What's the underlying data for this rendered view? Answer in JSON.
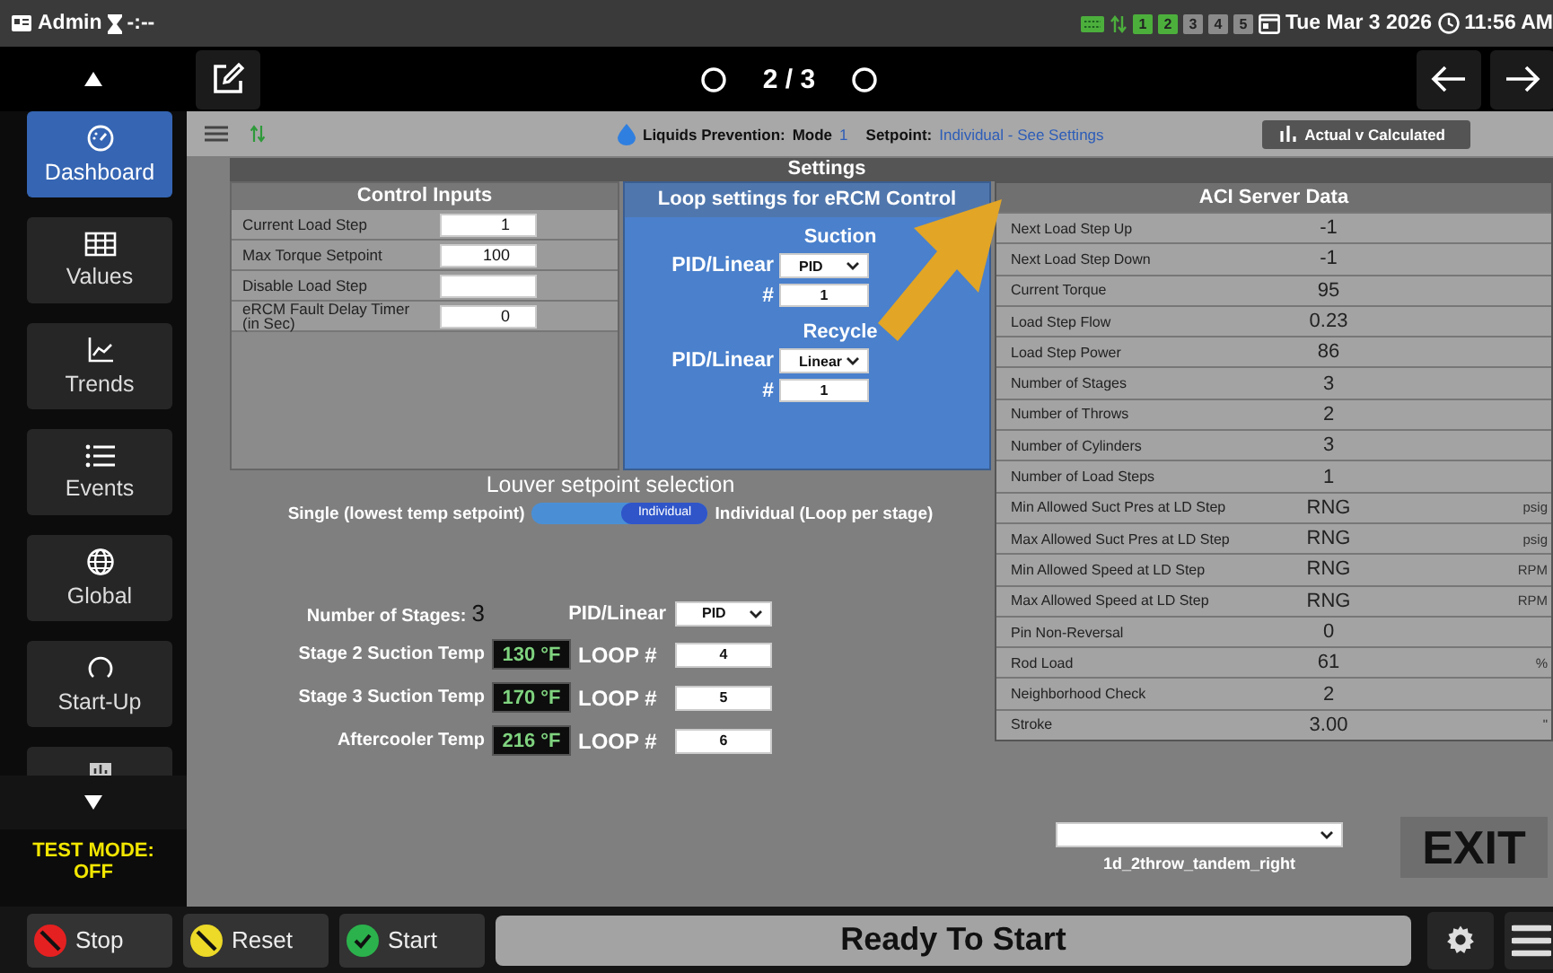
{
  "top_bar": {
    "user": "Admin",
    "timer": "-:--",
    "channels": [
      {
        "label": "1",
        "on": true
      },
      {
        "label": "2",
        "on": true
      },
      {
        "label": "3",
        "on": false
      },
      {
        "label": "4",
        "on": false
      },
      {
        "label": "5",
        "on": false
      }
    ],
    "date": "Tue Mar 3 2026",
    "time": "11:56 AM"
  },
  "nav_bar": {
    "page": "2 / 3"
  },
  "sidebar": {
    "items": [
      {
        "label": "Dashboard",
        "selected": true
      },
      {
        "label": "Values",
        "selected": false
      },
      {
        "label": "Trends",
        "selected": false
      },
      {
        "label": "Events",
        "selected": false
      },
      {
        "label": "Global",
        "selected": false
      },
      {
        "label": "Start-Up",
        "selected": false
      },
      {
        "selected": false
      }
    ],
    "test_mode": {
      "label": "TEST MODE:",
      "value": "OFF"
    }
  },
  "toolbar": {
    "mode_label": "Liquids Prevention:",
    "mode_word": "Mode",
    "mode": "1",
    "setpoint_label": "Setpoint:",
    "setpoint": "Individual - See Settings",
    "button": "Actual v Calculated"
  },
  "settings": {
    "title": "Settings",
    "control_inputs": {
      "title": "Control Inputs",
      "rows": [
        {
          "label": "Current Load Step",
          "value": "1"
        },
        {
          "label": "Max Torque Setpoint",
          "value": "100"
        },
        {
          "label": "Disable Load Step",
          "value": ""
        },
        {
          "label": "eRCM Fault Delay Timer (in Sec)",
          "value": "0"
        }
      ]
    },
    "loop_settings": {
      "title": "Loop settings for eRCM Control",
      "groups": [
        {
          "title": "Suction",
          "mode_label": "PID/Linear",
          "mode": "PID",
          "number_label": "#",
          "number": "1"
        },
        {
          "title": "Recycle",
          "mode_label": "PID/Linear",
          "mode": "Linear",
          "number_label": "#",
          "number": "1"
        }
      ]
    },
    "louver": {
      "title": "Louver setpoint selection",
      "left_label": "Single (lowest temp setpoint)",
      "toggle": {
        "label": "Individual",
        "on": true
      },
      "right_label": "Individual (Loop per stage)"
    },
    "stages": {
      "count_label": "Number of Stages:",
      "count": "3",
      "mode_label": "PID/Linear",
      "mode": "PID",
      "rows": [
        {
          "label": "Stage 2 Suction Temp",
          "temp": "130 °F",
          "loop_label": "LOOP #",
          "loop": "4"
        },
        {
          "label": "Stage 3 Suction Temp",
          "temp": "170 °F",
          "loop_label": "LOOP #",
          "loop": "5"
        },
        {
          "label": "Aftercooler Temp",
          "temp": "216 °F",
          "loop_label": "LOOP #",
          "loop": "6"
        }
      ]
    },
    "aci_server_data": {
      "title": "ACI Server Data",
      "rows": [
        {
          "label": "Next Load Step Up",
          "value": "-1"
        },
        {
          "label": "Next Load Step Down",
          "value": "-1"
        },
        {
          "label": "Current Torque",
          "value": "95"
        },
        {
          "label": "Load Step Flow",
          "value": "0.23"
        },
        {
          "label": "Load Step Power",
          "value": "86"
        },
        {
          "label": "Number of Stages",
          "value": "3"
        },
        {
          "label": "Number of Throws",
          "value": "2"
        },
        {
          "label": "Number of Cylinders",
          "value": "3"
        },
        {
          "label": "Number of Load Steps",
          "value": "1"
        },
        {
          "label": "Min Allowed Suct Pres at LD Step",
          "value": "RNG",
          "unit": "psig"
        },
        {
          "label": "Max Allowed Suct Pres at LD Step",
          "value": "RNG",
          "unit": "psig"
        },
        {
          "label": "Min Allowed Speed at LD Step",
          "value": "RNG",
          "unit": "RPM"
        },
        {
          "label": "Max Allowed Speed at LD Step",
          "value": "RNG",
          "unit": "RPM"
        },
        {
          "label": "Pin Non-Reversal",
          "value": "0"
        },
        {
          "label": "Rod Load",
          "value": "61",
          "unit": "%"
        },
        {
          "label": "Neighborhood Check",
          "value": "2"
        },
        {
          "label": "Stroke",
          "value": "3.00",
          "unit": "\""
        }
      ]
    }
  },
  "config": {
    "label": "1d_2throw_tandem_right"
  },
  "exit": "EXIT",
  "bottom_bar": {
    "buttons": [
      {
        "kind": "stop",
        "label": "Stop"
      },
      {
        "kind": "reset",
        "label": "Reset"
      },
      {
        "kind": "start",
        "label": "Start"
      }
    ],
    "status": "Ready To Start"
  }
}
